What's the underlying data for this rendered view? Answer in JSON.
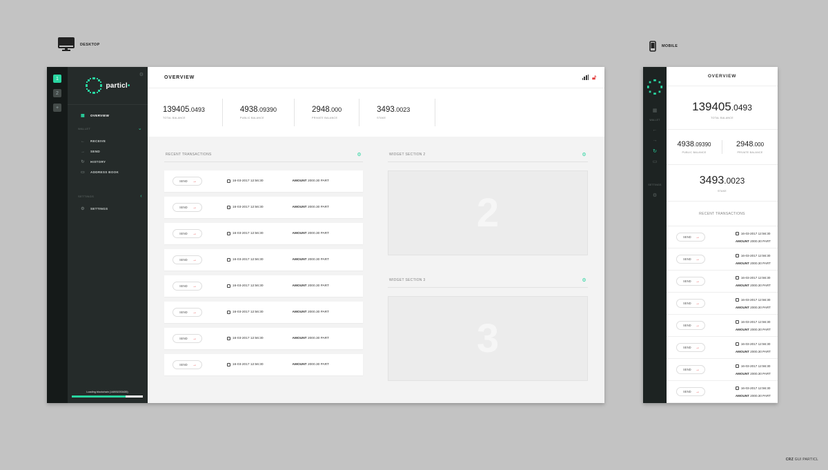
{
  "labels": {
    "desktop": "DESKTOP",
    "mobile": "MOBILE",
    "credit_bold": "CRZ",
    "credit_rest": " GUI PARTICL"
  },
  "brand": {
    "name": "particl",
    "dot": "•",
    "accent": "#29d5a0",
    "alert": "#e23b3b"
  },
  "rail": {
    "items": [
      "1",
      "2",
      "+"
    ]
  },
  "sidebar": {
    "overview": "OVERVIEW",
    "wallet_section": "WALLET",
    "wallet_items": [
      {
        "label": "RECEIVE",
        "icon": "arrow-left-icon"
      },
      {
        "label": "SEND",
        "icon": "arrow-right-icon"
      },
      {
        "label": "HISTORY",
        "icon": "refresh-icon"
      },
      {
        "label": "ADDRESS BOOK",
        "icon": "address-book-icon"
      }
    ],
    "settings_section": "SETTINGS",
    "settings_item": "SETTINGS",
    "loading_text": "Loading blockchain (14893/203435)",
    "loading_progress": 0.76
  },
  "header": {
    "title": "OVERVIEW"
  },
  "balances": [
    {
      "int": "139405",
      "dec": ".0493",
      "label": "TOTAL BALANCE"
    },
    {
      "int": "4938",
      "dec": ".09390",
      "label": "PUBLIC BALANCE"
    },
    {
      "int": "2948",
      "dec": ".000",
      "label": "PRIVATE BALANCE"
    },
    {
      "int": "3493",
      "dec": ".0023",
      "label": "STAKE"
    }
  ],
  "transactions": {
    "title": "RECENT TRANSACTIONS",
    "rows": [
      {
        "type": "SEND",
        "date": "16-03-2017 12:56:30",
        "amount_label": "AMOUNT",
        "amount": "2000.30 PART"
      },
      {
        "type": "SEND",
        "date": "16-03-2017 12:56:30",
        "amount_label": "AMOUNT",
        "amount": "2000.30 PART"
      },
      {
        "type": "SEND",
        "date": "16-03-2017 12:56:30",
        "amount_label": "AMOUNT",
        "amount": "2000.30 PART"
      },
      {
        "type": "SEND",
        "date": "16-03-2017 12:56:30",
        "amount_label": "AMOUNT",
        "amount": "2000.30 PART"
      },
      {
        "type": "SEND",
        "date": "16-03-2017 12:56:30",
        "amount_label": "AMOUNT",
        "amount": "2000.30 PART"
      },
      {
        "type": "SEND",
        "date": "16-03-2017 12:56:30",
        "amount_label": "AMOUNT",
        "amount": "2000.30 PART"
      },
      {
        "type": "SEND",
        "date": "16-03-2017 12:56:30",
        "amount_label": "AMOUNT",
        "amount": "2000.30 PART"
      },
      {
        "type": "SEND",
        "date": "16-03-2017 12:56:30",
        "amount_label": "AMOUNT",
        "amount": "2000.30 PART"
      }
    ]
  },
  "widgets": [
    {
      "title": "WIDGET SECTION 2",
      "number": "2"
    },
    {
      "title": "WIDGET SECTION 3",
      "number": "3"
    }
  ],
  "mobile": {
    "title": "OVERVIEW",
    "wallet_section": "WALLET",
    "settings_section": "SETTINGS"
  }
}
